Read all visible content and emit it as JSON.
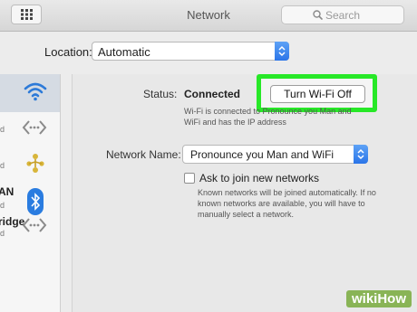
{
  "window": {
    "title": "Network"
  },
  "search": {
    "placeholder": "Search"
  },
  "location": {
    "label": "Location:",
    "value": "Automatic"
  },
  "sidebar": {
    "items": [
      {
        "name": "",
        "sub": "",
        "icon": "wifi-icon"
      },
      {
        "name": "",
        "sub": "d",
        "icon": "ethernet-icon"
      },
      {
        "name": "",
        "sub": "d",
        "icon": "firewire-icon"
      },
      {
        "name": "AN",
        "sub": "d",
        "icon": "bluetooth-icon"
      },
      {
        "name": "ridge",
        "sub": "d",
        "icon": "thunderbolt-bridge-icon"
      }
    ]
  },
  "status": {
    "label": "Status:",
    "value": "Connected",
    "button_label": "Turn Wi-Fi Off",
    "description": "Wi-Fi is connected to Pronounce you Man and WiFi and has the IP address"
  },
  "network_name": {
    "label": "Network Name:",
    "value": "Pronounce you Man and WiFi"
  },
  "ask_join": {
    "label": "Ask to join new networks",
    "checked": false,
    "description": "Known networks will be joined automatically. If no known networks are available, you will have to manually select a network."
  },
  "colors": {
    "accent": "#2b75e8",
    "highlight": "#27e827"
  },
  "watermark": "wikiHow"
}
